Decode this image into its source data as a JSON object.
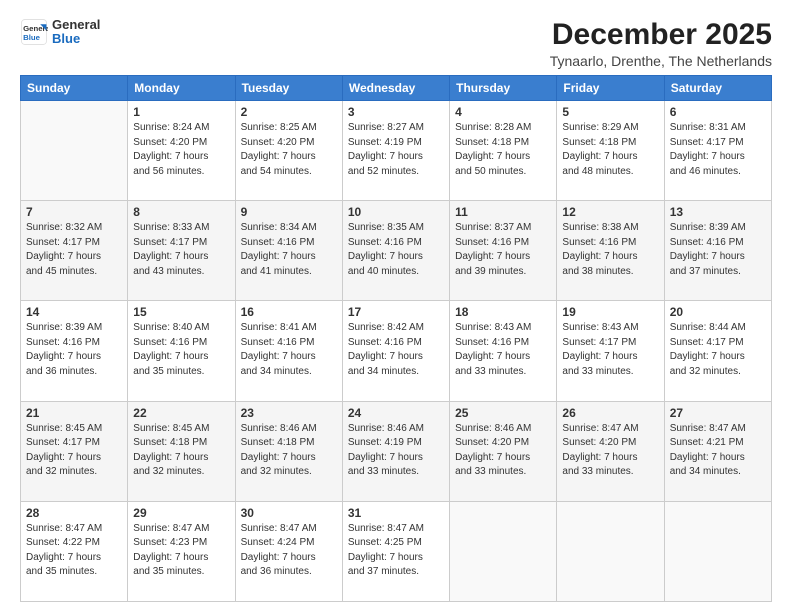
{
  "logo": {
    "line1": "General",
    "line2": "Blue"
  },
  "title": "December 2025",
  "subtitle": "Tynaarlo, Drenthe, The Netherlands",
  "header_days": [
    "Sunday",
    "Monday",
    "Tuesday",
    "Wednesday",
    "Thursday",
    "Friday",
    "Saturday"
  ],
  "weeks": [
    [
      {
        "day": "",
        "info": ""
      },
      {
        "day": "1",
        "info": "Sunrise: 8:24 AM\nSunset: 4:20 PM\nDaylight: 7 hours\nand 56 minutes."
      },
      {
        "day": "2",
        "info": "Sunrise: 8:25 AM\nSunset: 4:20 PM\nDaylight: 7 hours\nand 54 minutes."
      },
      {
        "day": "3",
        "info": "Sunrise: 8:27 AM\nSunset: 4:19 PM\nDaylight: 7 hours\nand 52 minutes."
      },
      {
        "day": "4",
        "info": "Sunrise: 8:28 AM\nSunset: 4:18 PM\nDaylight: 7 hours\nand 50 minutes."
      },
      {
        "day": "5",
        "info": "Sunrise: 8:29 AM\nSunset: 4:18 PM\nDaylight: 7 hours\nand 48 minutes."
      },
      {
        "day": "6",
        "info": "Sunrise: 8:31 AM\nSunset: 4:17 PM\nDaylight: 7 hours\nand 46 minutes."
      }
    ],
    [
      {
        "day": "7",
        "info": "Sunrise: 8:32 AM\nSunset: 4:17 PM\nDaylight: 7 hours\nand 45 minutes."
      },
      {
        "day": "8",
        "info": "Sunrise: 8:33 AM\nSunset: 4:17 PM\nDaylight: 7 hours\nand 43 minutes."
      },
      {
        "day": "9",
        "info": "Sunrise: 8:34 AM\nSunset: 4:16 PM\nDaylight: 7 hours\nand 41 minutes."
      },
      {
        "day": "10",
        "info": "Sunrise: 8:35 AM\nSunset: 4:16 PM\nDaylight: 7 hours\nand 40 minutes."
      },
      {
        "day": "11",
        "info": "Sunrise: 8:37 AM\nSunset: 4:16 PM\nDaylight: 7 hours\nand 39 minutes."
      },
      {
        "day": "12",
        "info": "Sunrise: 8:38 AM\nSunset: 4:16 PM\nDaylight: 7 hours\nand 38 minutes."
      },
      {
        "day": "13",
        "info": "Sunrise: 8:39 AM\nSunset: 4:16 PM\nDaylight: 7 hours\nand 37 minutes."
      }
    ],
    [
      {
        "day": "14",
        "info": "Sunrise: 8:39 AM\nSunset: 4:16 PM\nDaylight: 7 hours\nand 36 minutes."
      },
      {
        "day": "15",
        "info": "Sunrise: 8:40 AM\nSunset: 4:16 PM\nDaylight: 7 hours\nand 35 minutes."
      },
      {
        "day": "16",
        "info": "Sunrise: 8:41 AM\nSunset: 4:16 PM\nDaylight: 7 hours\nand 34 minutes."
      },
      {
        "day": "17",
        "info": "Sunrise: 8:42 AM\nSunset: 4:16 PM\nDaylight: 7 hours\nand 34 minutes."
      },
      {
        "day": "18",
        "info": "Sunrise: 8:43 AM\nSunset: 4:16 PM\nDaylight: 7 hours\nand 33 minutes."
      },
      {
        "day": "19",
        "info": "Sunrise: 8:43 AM\nSunset: 4:17 PM\nDaylight: 7 hours\nand 33 minutes."
      },
      {
        "day": "20",
        "info": "Sunrise: 8:44 AM\nSunset: 4:17 PM\nDaylight: 7 hours\nand 32 minutes."
      }
    ],
    [
      {
        "day": "21",
        "info": "Sunrise: 8:45 AM\nSunset: 4:17 PM\nDaylight: 7 hours\nand 32 minutes."
      },
      {
        "day": "22",
        "info": "Sunrise: 8:45 AM\nSunset: 4:18 PM\nDaylight: 7 hours\nand 32 minutes."
      },
      {
        "day": "23",
        "info": "Sunrise: 8:46 AM\nSunset: 4:18 PM\nDaylight: 7 hours\nand 32 minutes."
      },
      {
        "day": "24",
        "info": "Sunrise: 8:46 AM\nSunset: 4:19 PM\nDaylight: 7 hours\nand 33 minutes."
      },
      {
        "day": "25",
        "info": "Sunrise: 8:46 AM\nSunset: 4:20 PM\nDaylight: 7 hours\nand 33 minutes."
      },
      {
        "day": "26",
        "info": "Sunrise: 8:47 AM\nSunset: 4:20 PM\nDaylight: 7 hours\nand 33 minutes."
      },
      {
        "day": "27",
        "info": "Sunrise: 8:47 AM\nSunset: 4:21 PM\nDaylight: 7 hours\nand 34 minutes."
      }
    ],
    [
      {
        "day": "28",
        "info": "Sunrise: 8:47 AM\nSunset: 4:22 PM\nDaylight: 7 hours\nand 35 minutes."
      },
      {
        "day": "29",
        "info": "Sunrise: 8:47 AM\nSunset: 4:23 PM\nDaylight: 7 hours\nand 35 minutes."
      },
      {
        "day": "30",
        "info": "Sunrise: 8:47 AM\nSunset: 4:24 PM\nDaylight: 7 hours\nand 36 minutes."
      },
      {
        "day": "31",
        "info": "Sunrise: 8:47 AM\nSunset: 4:25 PM\nDaylight: 7 hours\nand 37 minutes."
      },
      {
        "day": "",
        "info": ""
      },
      {
        "day": "",
        "info": ""
      },
      {
        "day": "",
        "info": ""
      }
    ]
  ]
}
